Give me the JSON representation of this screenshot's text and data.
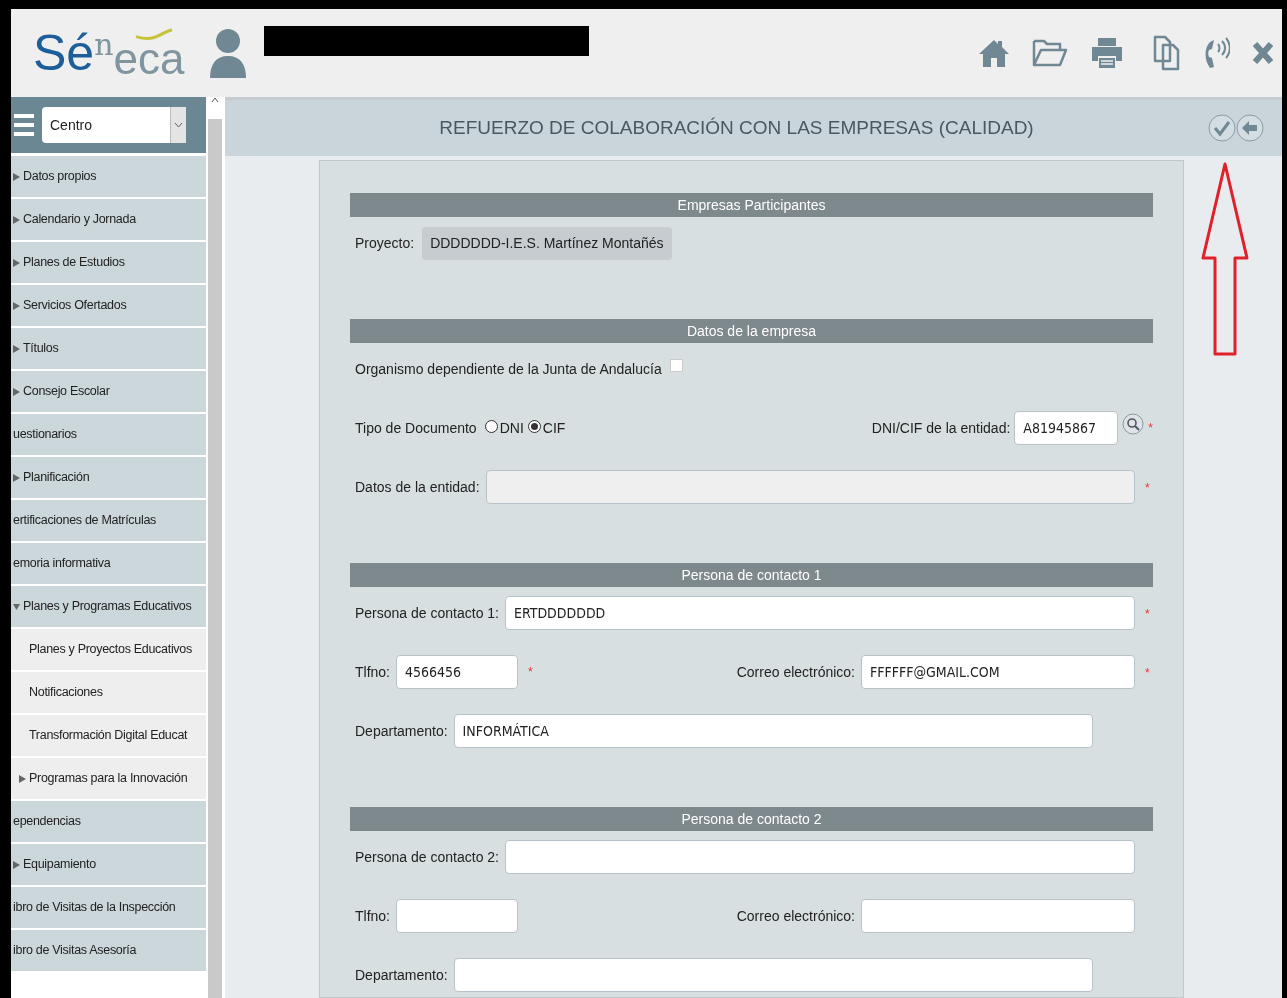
{
  "logo": {
    "parts": [
      "Sé",
      "n",
      "eca"
    ]
  },
  "sidebar": {
    "select": {
      "value": "Centro"
    },
    "items": [
      {
        "label": "Datos propios",
        "kind": "group",
        "expanded": false
      },
      {
        "label": "Calendario y Jornada",
        "kind": "group",
        "expanded": false
      },
      {
        "label": "Planes de Estudios",
        "kind": "group",
        "expanded": false
      },
      {
        "label": "Servicios Ofertados",
        "kind": "group",
        "expanded": false
      },
      {
        "label": "Títulos",
        "kind": "group",
        "expanded": false
      },
      {
        "label": "Consejo Escolar",
        "kind": "group",
        "expanded": false
      },
      {
        "label": "uestionarios",
        "kind": "link"
      },
      {
        "label": "Planificación",
        "kind": "group",
        "expanded": false
      },
      {
        "label": "ertificaciones de Matrículas",
        "kind": "link"
      },
      {
        "label": "emoria informativa",
        "kind": "link"
      },
      {
        "label": "Planes y Programas Educativos",
        "kind": "group",
        "expanded": true,
        "children": [
          {
            "label": "Planes y Proyectos Educativos",
            "kind": "link"
          },
          {
            "label": "Notificaciones",
            "kind": "link"
          },
          {
            "label": "Transformación Digital Educat",
            "kind": "link"
          },
          {
            "label": "Programas para la Innovación",
            "kind": "group",
            "expanded": false
          }
        ]
      },
      {
        "label": "ependencias",
        "kind": "link"
      },
      {
        "label": "Equipamiento",
        "kind": "group",
        "expanded": false
      },
      {
        "label": "ibro de Visitas de la Inspección",
        "kind": "link"
      },
      {
        "label": "ibro de Visitas Asesoría",
        "kind": "link"
      }
    ]
  },
  "page": {
    "title": "REFUERZO DE COLABORACIÓN CON LAS EMPRESAS (CALIDAD)",
    "sections": [
      {
        "title": "Empresas Participantes",
        "rows": [
          {
            "kind": "readonly",
            "label": "Proyecto:",
            "value": "DDDDDDD-I.E.S. Martínez Montañés"
          }
        ]
      },
      {
        "title": "Datos de la empresa",
        "rows": [
          {
            "kind": "checkbox",
            "label": "Organismo dependiente de la Junta de Andalucía",
            "checked": false
          },
          {
            "kind": "doc",
            "label": "Tipo de Documento",
            "options": [
              {
                "label": "DNI",
                "selected": false
              },
              {
                "label": "CIF",
                "selected": true
              }
            ],
            "right": {
              "label": "DNI/CIF de la entidad:",
              "value": "A81945867",
              "required_mark": "*"
            }
          },
          {
            "kind": "text",
            "label": "Datos de la entidad:",
            "disabled": true,
            "required_mark": "*"
          }
        ]
      },
      {
        "title": "Persona de contacto 1",
        "rows": [
          {
            "kind": "text",
            "label": "Persona de contacto 1:",
            "value": "ERTDDDDDDD",
            "disabled": false,
            "required_mark": "*"
          },
          {
            "kind": "pair",
            "left": {
              "label": "Tlfno:",
              "value": "4566456",
              "required_mark": "*"
            },
            "right": {
              "label": "Correo electrónico:",
              "value": "FFFFFF@GMAIL.COM",
              "required_mark": "*"
            }
          },
          {
            "kind": "text-short",
            "label": "Departamento:",
            "value": "INFORMÁTICA",
            "disabled": false
          }
        ]
      },
      {
        "title": "Persona de contacto 2",
        "rows": [
          {
            "kind": "text",
            "label": "Persona de contacto 2:",
            "disabled": false
          },
          {
            "kind": "pair",
            "left": {
              "label": "Tlfno:"
            },
            "right": {
              "label": "Correo electrónico:"
            }
          },
          {
            "kind": "text-short",
            "label": "Departamento:",
            "disabled": false
          }
        ]
      }
    ]
  }
}
